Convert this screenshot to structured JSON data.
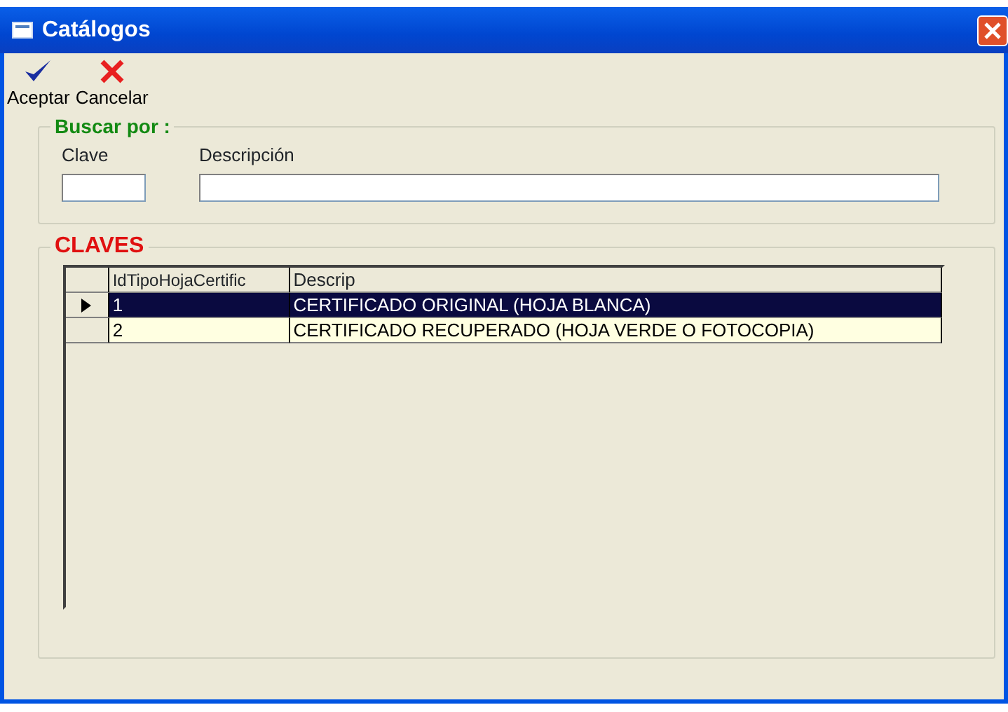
{
  "window": {
    "title": "Catálogos"
  },
  "toolbar": [
    {
      "label": "Aceptar",
      "kind": "accept"
    },
    {
      "label": "Cancelar",
      "kind": "cancel"
    }
  ],
  "search": {
    "title": "Buscar por :",
    "fields": [
      {
        "label": "Clave",
        "kind": "short"
      },
      {
        "label": "Descripción",
        "kind": "wide"
      }
    ]
  },
  "table": {
    "title": "CLAVES",
    "columns": [
      "IdTipoHojaCertific",
      "Descrip"
    ],
    "rows": [
      {
        "cells": [
          "1",
          "CERTIFICADO ORIGINAL (HOJA BLANCA)"
        ],
        "selected": true,
        "current": true
      },
      {
        "cells": [
          "2",
          "CERTIFICADO RECUPERADO (HOJA VERDE O FOTOCOPIA)"
        ],
        "selected": false,
        "current": false
      }
    ]
  }
}
